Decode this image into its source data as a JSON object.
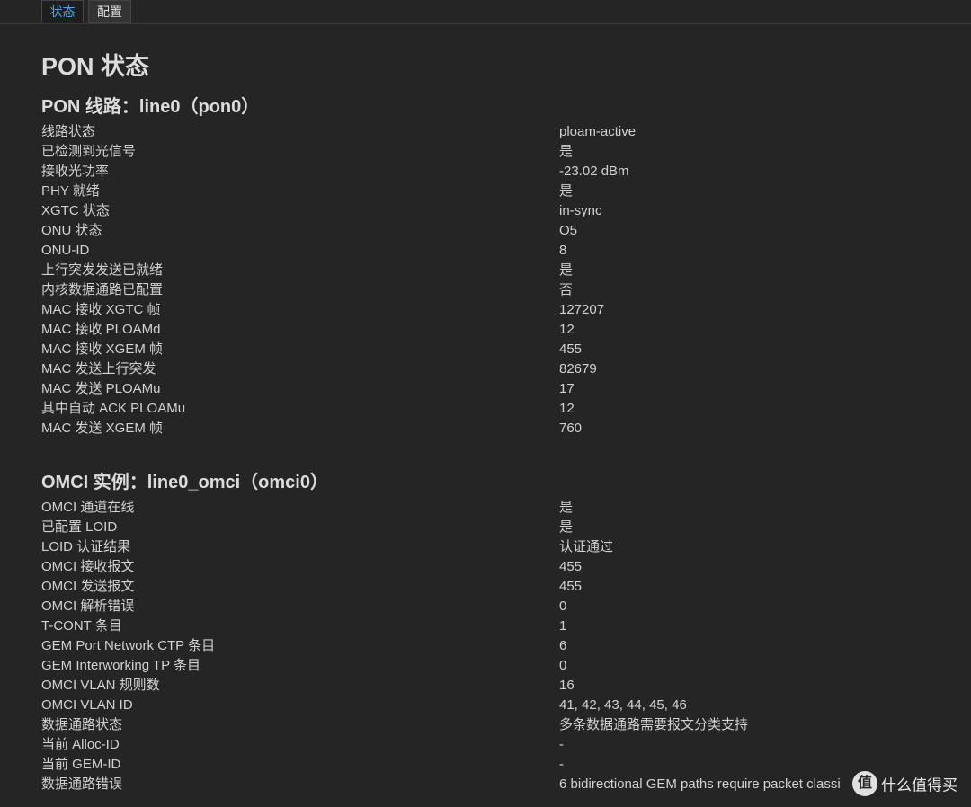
{
  "tabs": [
    {
      "label": "状态"
    },
    {
      "label": "配置"
    }
  ],
  "page_title": "PON 状态",
  "sections": [
    {
      "title": "PON 线路：line0（pon0）",
      "rows": [
        {
          "key": "线路状态",
          "value": "ploam-active"
        },
        {
          "key": "已检测到光信号",
          "value": "是"
        },
        {
          "key": "接收光功率",
          "value": "-23.02 dBm"
        },
        {
          "key": "PHY 就绪",
          "value": "是"
        },
        {
          "key": "XGTC 状态",
          "value": "in-sync"
        },
        {
          "key": "ONU 状态",
          "value": "O5"
        },
        {
          "key": "ONU-ID",
          "value": "8"
        },
        {
          "key": "上行突发发送已就绪",
          "value": "是"
        },
        {
          "key": "内核数据通路已配置",
          "value": "否"
        },
        {
          "key": "MAC 接收 XGTC 帧",
          "value": "127207"
        },
        {
          "key": "MAC 接收 PLOAMd",
          "value": "12"
        },
        {
          "key": "MAC 接收 XGEM 帧",
          "value": "455"
        },
        {
          "key": "MAC 发送上行突发",
          "value": "82679"
        },
        {
          "key": "MAC 发送 PLOAMu",
          "value": "17"
        },
        {
          "key": "其中自动 ACK PLOAMu",
          "value": "12"
        },
        {
          "key": "MAC 发送 XGEM 帧",
          "value": "760"
        }
      ]
    },
    {
      "title": "OMCI 实例：line0_omci（omci0）",
      "rows": [
        {
          "key": "OMCI 通道在线",
          "value": "是"
        },
        {
          "key": "已配置 LOID",
          "value": "是"
        },
        {
          "key": "LOID 认证结果",
          "value": "认证通过"
        },
        {
          "key": "OMCI 接收报文",
          "value": "455"
        },
        {
          "key": "OMCI 发送报文",
          "value": "455"
        },
        {
          "key": "OMCI 解析错误",
          "value": "0"
        },
        {
          "key": "T-CONT 条目",
          "value": "1"
        },
        {
          "key": "GEM Port Network CTP 条目",
          "value": "6"
        },
        {
          "key": "GEM Interworking TP 条目",
          "value": "0"
        },
        {
          "key": "OMCI VLAN 规则数",
          "value": "16"
        },
        {
          "key": "OMCI VLAN ID",
          "value": "41, 42, 43, 44, 45, 46"
        },
        {
          "key": "数据通路状态",
          "value": "多条数据通路需要报文分类支持"
        },
        {
          "key": "当前 Alloc-ID",
          "value": "-"
        },
        {
          "key": "当前 GEM-ID",
          "value": "-"
        },
        {
          "key": "数据通路错误",
          "value": "6 bidirectional GEM paths require packet classi"
        }
      ]
    }
  ],
  "watermark": {
    "badge": "值",
    "text": "什么值得买"
  }
}
